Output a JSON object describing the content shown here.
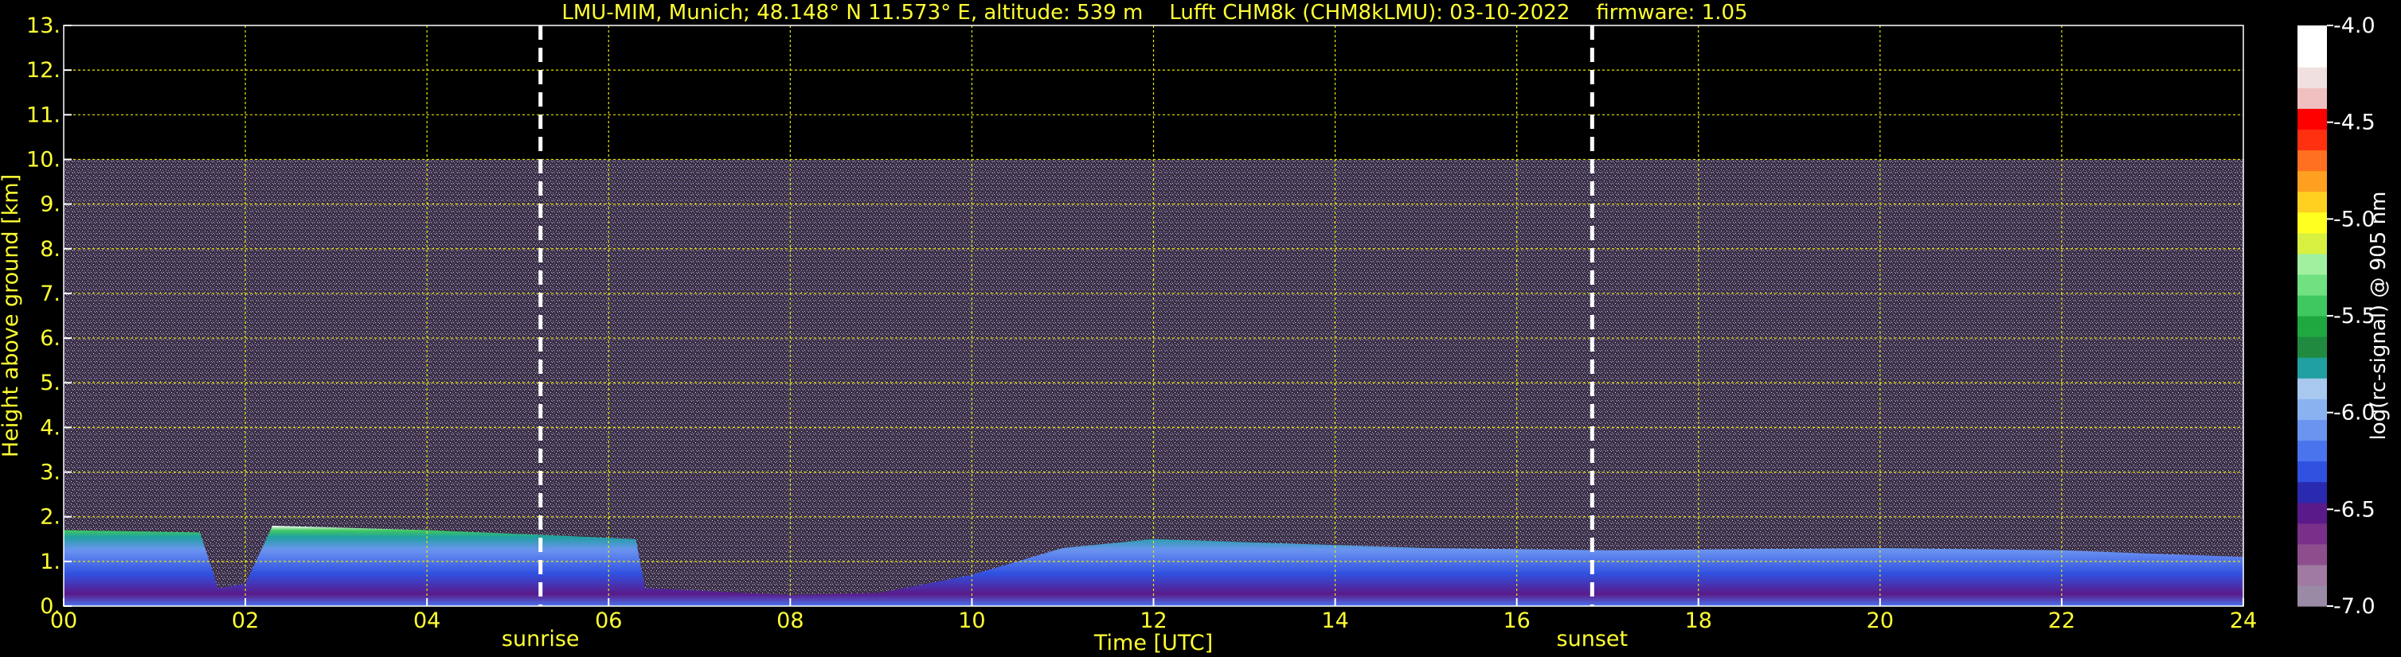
{
  "chart_data": {
    "type": "heatmap",
    "title": "LMU-MIM, Munich; 48.148° N 11.573° E, altitude: 539 m    Lufft CHM8k (CHM8kLMU): 03-10-2022    firmware: 1.05",
    "xlabel": "Time [UTC]",
    "ylabel": "Height above ground [km]",
    "xlim": [
      0,
      24
    ],
    "ylim": [
      0,
      13
    ],
    "x_ticks": [
      "00",
      "02",
      "04",
      "06",
      "08",
      "10",
      "12",
      "14",
      "16",
      "18",
      "20",
      "22",
      "24"
    ],
    "y_ticks": [
      "0.",
      "1.",
      "2.",
      "3.",
      "4.",
      "5.",
      "6.",
      "7.",
      "8.",
      "9.",
      "10.",
      "11.",
      "12.",
      "13."
    ],
    "grid": true,
    "measurement_top_km": 10,
    "events": [
      {
        "label": "sunrise",
        "time_utc": 5.25
      },
      {
        "label": "sunset",
        "time_utc": 16.83
      }
    ],
    "aerosol_layer_top_km": [
      {
        "t": 0.0,
        "h": 1.7
      },
      {
        "t": 1.5,
        "h": 1.65
      },
      {
        "t": 1.7,
        "h": 0.4
      },
      {
        "t": 2.0,
        "h": 0.5
      },
      {
        "t": 2.3,
        "h": 1.8
      },
      {
        "t": 4.0,
        "h": 1.7
      },
      {
        "t": 5.2,
        "h": 1.6
      },
      {
        "t": 6.3,
        "h": 1.5
      },
      {
        "t": 6.4,
        "h": 0.4
      },
      {
        "t": 8.0,
        "h": 0.25
      },
      {
        "t": 9.0,
        "h": 0.3
      },
      {
        "t": 10.0,
        "h": 0.7
      },
      {
        "t": 11.0,
        "h": 1.3
      },
      {
        "t": 12.0,
        "h": 1.5
      },
      {
        "t": 13.5,
        "h": 1.4
      },
      {
        "t": 15.0,
        "h": 1.3
      },
      {
        "t": 17.0,
        "h": 1.25
      },
      {
        "t": 20.0,
        "h": 1.3
      },
      {
        "t": 22.0,
        "h": 1.25
      },
      {
        "t": 24.0,
        "h": 1.1
      }
    ],
    "colorbar": {
      "label": "log(rc-signal) @ 905 nm",
      "range": [
        -7.0,
        -4.0
      ],
      "ticks": [
        "-4.0",
        "-4.5",
        "-5.0",
        "-5.5",
        "-6.0",
        "-6.5",
        "-7.0"
      ],
      "colors_bottom_to_top": [
        "#9a8aa6",
        "#a07aa0",
        "#8e4e8e",
        "#7a2f8a",
        "#5a1a8a",
        "#2a2ab0",
        "#3050e0",
        "#4a74ee",
        "#6a94f0",
        "#8ab2f0",
        "#a8c8f0",
        "#20a0a0",
        "#208a40",
        "#20a840",
        "#40c860",
        "#70e080",
        "#a0f0a0",
        "#d8f040",
        "#ffff20",
        "#ffd020",
        "#ffa020",
        "#ff7020",
        "#ff3010",
        "#ff0000",
        "#f0c0c0",
        "#f0e0e0",
        "#ffffff",
        "#ffffff"
      ]
    }
  }
}
